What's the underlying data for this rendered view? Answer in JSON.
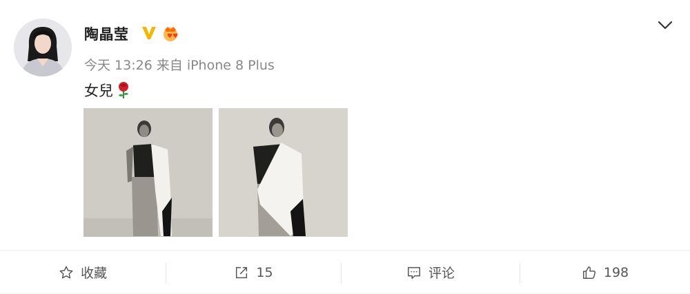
{
  "post": {
    "username": "陶晶莹",
    "meta": {
      "time": "今天 13:26",
      "source_prefix": "来自",
      "device": "iPhone 8 Plus"
    },
    "text": "女兒",
    "emoji_icon": "rose-icon",
    "images": [
      {
        "icon": "photo-model-black-white"
      },
      {
        "icon": "photo-model-black-white"
      }
    ]
  },
  "badges": {
    "verified_icon": "verified-v-icon",
    "verified_color": "#f5b800",
    "vip_icon": "vip-badge-icon",
    "vip_color": "#ff6a00"
  },
  "actions": {
    "favorite_label": "收藏",
    "share_count": "15",
    "comment_label": "评论",
    "like_count": "198"
  },
  "colors": {
    "text_primary": "#1e1e1e",
    "text_secondary": "#888888",
    "action_text": "#555555"
  }
}
